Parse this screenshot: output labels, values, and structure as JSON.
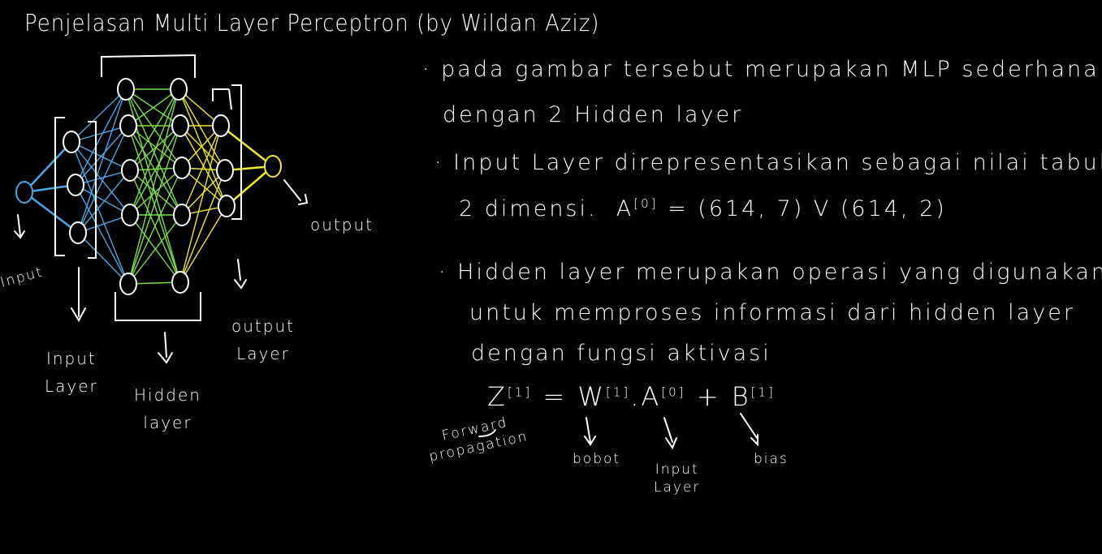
{
  "title": "Penjelasan Multi Layer Perceptron (by Wildan Aziz)",
  "diagram": {
    "layer_sizes": [
      1,
      3,
      5,
      5,
      3,
      1
    ],
    "colors": {
      "input": "#4aa8e8",
      "hidden1": "#7be04a",
      "hidden2": "#f2ea2a",
      "output": "#f2ea2a",
      "neuron": "#ffffff"
    },
    "labels": {
      "input": "Input",
      "input_layer": [
        "Input",
        "Layer"
      ],
      "hidden_layer": [
        "Hidden",
        "layer"
      ],
      "output_layer": [
        "output",
        "Layer"
      ],
      "output": "output"
    }
  },
  "notes": {
    "bullet1": [
      "pada gambar tersebut merupakan MLP sederhana",
      "dengan 2 Hidden layer"
    ],
    "bullet2": [
      "Input Layer direpresentasikan sebagai nilai tabular",
      "2 dimensi"
    ],
    "bullet2_formula": {
      "lhs": "A",
      "sup": "[0]",
      "rhs": "= (614, 7) V (614, 2)"
    },
    "bullet3": [
      "Hidden layer merupakan operasi yang digunakan",
      "untuk memproses informasi dari hidden layer",
      "dengan fungsi aktivasi"
    ],
    "formula": {
      "z": "Z",
      "z_sup": "[1]",
      "eq": "=",
      "w": "W",
      "w_sup": "[1]",
      "dot": ".",
      "a": "A",
      "a_sup": "[0]",
      "plus": "+",
      "b": "B",
      "b_sup": "[1]"
    },
    "annotations": {
      "forward": [
        "Forward",
        "propagation"
      ],
      "bobot": "bobot",
      "input_layer": [
        "Input",
        "Layer"
      ],
      "bias": "bias"
    }
  }
}
